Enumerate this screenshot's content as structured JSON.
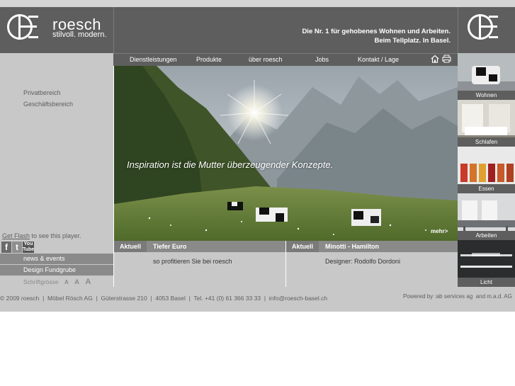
{
  "brand": {
    "name": "roesch",
    "slogan": "stilvoll. modern.",
    "tagline_line1": "Die Nr. 1 für gehobenes Wohnen und Arbeiten.",
    "tagline_line2": "Beim Tellplatz. In Basel."
  },
  "nav": {
    "items": [
      "Dienstleistungen",
      "Produkte",
      "über roesch",
      "Jobs",
      "Kontakt / Lage"
    ],
    "home_icon": "home-icon",
    "print_icon": "print-icon"
  },
  "sidebar": {
    "items": [
      "Privatbereich",
      "Geschäftsbereich"
    ],
    "flash_link": "Get Flash",
    "flash_note": " to see this player."
  },
  "social": {
    "facebook": "f",
    "twitter": "t",
    "youtube_line1": "You",
    "youtube_line2": "Tube"
  },
  "hero": {
    "text": "Inspiration ist die Mutter überzeugender Konzepte.",
    "more": "mehr>"
  },
  "categories": [
    "Wohnen",
    "Schlafen",
    "Essen",
    "Arbeiten",
    "Licht"
  ],
  "left_menu": {
    "items": [
      "news & events",
      "Design Fundgrube"
    ],
    "font_size_label": "Schriftgrösse",
    "font_sizes": [
      "A",
      "A",
      "A"
    ]
  },
  "news": [
    {
      "tag": "Aktuell",
      "title": "Tiefer Euro",
      "text": "so profitieren Sie bei roesch"
    },
    {
      "tag": "Aktuell",
      "title": "Minotti - Hamilton",
      "text": "Designer: Rodolfo Dordoni"
    }
  ],
  "footer": {
    "left": "© 2009 roesch  |  Möbel Rösch AG  |  Güterstrasse 210  |  4053 Basel  |  Tel. +41 (0) 61 366 33 33  |  info@roesch-basel.ch",
    "right": "Powered by :ab services ag  and m.a.d. AG"
  },
  "colors": {
    "dark_gray": "#5e5e5e",
    "mid_gray": "#8a8a8a",
    "light_gray": "#c8c8c8"
  }
}
